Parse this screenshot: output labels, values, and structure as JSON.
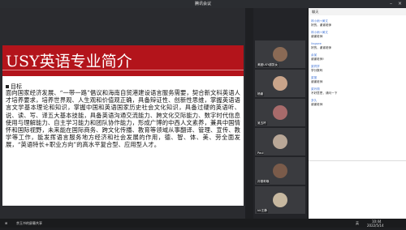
{
  "window": {
    "title": "腾讯会议"
  },
  "slide": {
    "title": "USY英语专业简介",
    "bullet_heading": "目标",
    "body": "面向国家经济发展、“一带一路”倡议和海南自贸港建设语言服务需要，契合新文科英语人才培养要求，培养世界观、人生观和价值观正确，具备辩证性、创新性思维，掌握英语语言文学基本理论和知识，掌握中国和英语国家历史社会文化知识，具备过硬的英语听、说、读、写、译五大基本技能，具备英语沟通交流能力、跨文化交际能力、数字时代信息使用与理解能力、自主学习能力和团队协作能力，形成广博的中西人文素养，兼具中国情怀和国际视野，未来能在国际商务、跨文化传播、教育等领域从事翻译、管理、宣传、教学等工作，能发挥语言服务地方经济和社会发展的作用，德、智、体、美、劳全面发展，“英语特长+职业方向”的高水平复合型、应用型人才。"
  },
  "video_tiles": [
    {
      "label": "美团USY越凯女",
      "face": "#8a6a55"
    },
    {
      "label": "杨景",
      "face": "#c9a48a"
    },
    {
      "label": "吴玉吟",
      "face": "#a86b6b"
    },
    {
      "label": "Paul",
      "face": "#b9a797"
    },
    {
      "label": "孙丽莉哦",
      "face": "#7a5b4a"
    },
    {
      "label": "hit王静",
      "face": "#c7b8a0"
    },
    {
      "label": "王晓娜",
      "face": "#d8d8d8"
    }
  ],
  "chat": {
    "header": "聊天",
    "messages": [
      {
        "name": "林小雨+黄文",
        "text": "好的，谢谢老师"
      },
      {
        "name": "林小雨+黄文",
        "text": "谢谢老师"
      },
      {
        "name": "lingsee",
        "text": "好的，谢谢老师"
      },
      {
        "name": "余某",
        "text": "谢谢老师!"
      },
      {
        "name": "梁同学",
        "text": "学分数吗"
      },
      {
        "name": "梁丽",
        "text": "谢谢老师"
      },
      {
        "name": "梁玲丽",
        "text": "不好意思，请问一下"
      },
      {
        "name": "多久",
        "text": "谢谢老师"
      }
    ]
  },
  "taskbar": {
    "meeting_label": "余玉书的屏幕共享",
    "time": "10:44",
    "date": "2022/5/14",
    "input_method": "英"
  }
}
